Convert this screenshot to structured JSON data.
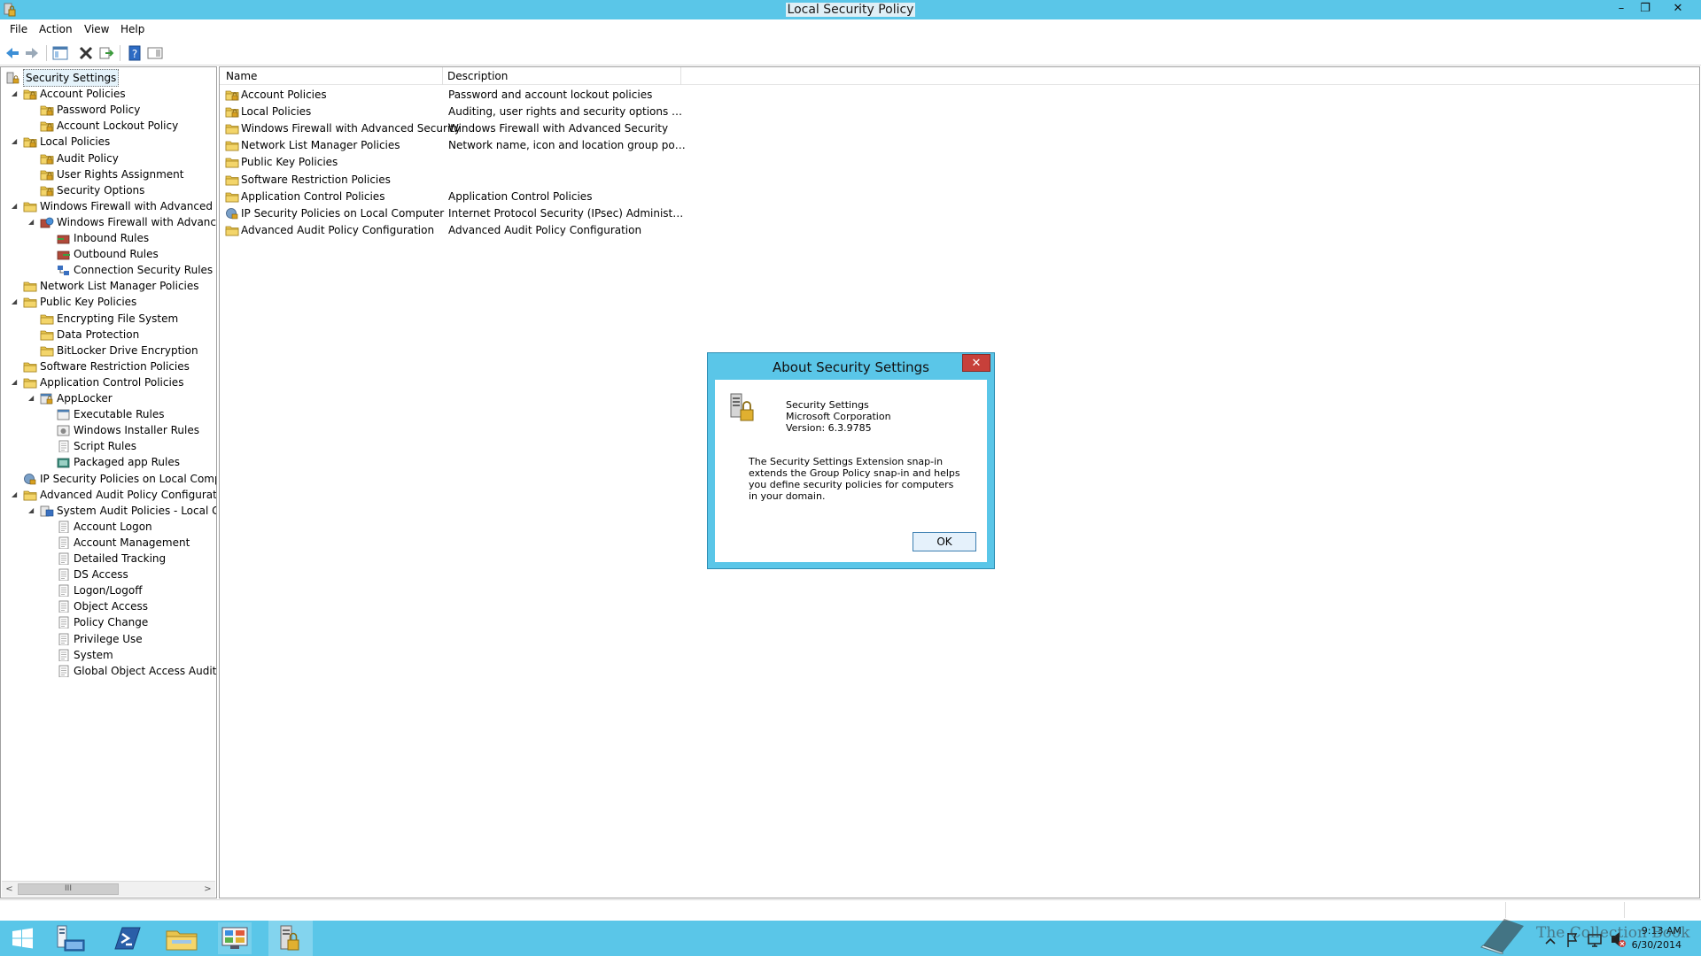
{
  "window": {
    "title": "Local Security Policy",
    "minimize": "–",
    "restore": "❐",
    "close": "✕"
  },
  "menu": [
    "File",
    "Action",
    "View",
    "Help"
  ],
  "tree": [
    {
      "label": "Security Settings",
      "level": 0,
      "expander": "",
      "icon": "security-settings-icon",
      "selected": true
    },
    {
      "label": "Account Policies",
      "level": 1,
      "expander": "◢",
      "icon": "folder-lock-icon"
    },
    {
      "label": "Password Policy",
      "level": 2,
      "expander": "",
      "icon": "folder-lock-icon"
    },
    {
      "label": "Account Lockout Policy",
      "level": 2,
      "expander": "",
      "icon": "folder-lock-icon"
    },
    {
      "label": "Local Policies",
      "level": 1,
      "expander": "◢",
      "icon": "folder-lock-icon"
    },
    {
      "label": "Audit Policy",
      "level": 2,
      "expander": "",
      "icon": "folder-lock-icon"
    },
    {
      "label": "User Rights Assignment",
      "level": 2,
      "expander": "",
      "icon": "folder-lock-icon"
    },
    {
      "label": "Security Options",
      "level": 2,
      "expander": "",
      "icon": "folder-lock-icon"
    },
    {
      "label": "Windows Firewall with Advanced Secu",
      "level": 1,
      "expander": "◢",
      "icon": "folder-icon"
    },
    {
      "label": "Windows Firewall with Advanced",
      "level": 2,
      "expander": "◢",
      "icon": "firewall-icon"
    },
    {
      "label": "Inbound Rules",
      "level": 3,
      "expander": "",
      "icon": "inbound-rules-icon"
    },
    {
      "label": "Outbound Rules",
      "level": 3,
      "expander": "",
      "icon": "outbound-rules-icon"
    },
    {
      "label": "Connection Security Rules",
      "level": 3,
      "expander": "",
      "icon": "connection-security-icon"
    },
    {
      "label": "Network List Manager Policies",
      "level": 1,
      "expander": "",
      "icon": "folder-icon"
    },
    {
      "label": "Public Key Policies",
      "level": 1,
      "expander": "◢",
      "icon": "folder-icon"
    },
    {
      "label": "Encrypting File System",
      "level": 2,
      "expander": "",
      "icon": "folder-icon"
    },
    {
      "label": "Data Protection",
      "level": 2,
      "expander": "",
      "icon": "folder-icon"
    },
    {
      "label": "BitLocker Drive Encryption",
      "level": 2,
      "expander": "",
      "icon": "folder-icon"
    },
    {
      "label": "Software Restriction Policies",
      "level": 1,
      "expander": "",
      "icon": "folder-icon"
    },
    {
      "label": "Application Control Policies",
      "level": 1,
      "expander": "◢",
      "icon": "folder-icon"
    },
    {
      "label": "AppLocker",
      "level": 2,
      "expander": "◢",
      "icon": "applocker-icon"
    },
    {
      "label": "Executable Rules",
      "level": 3,
      "expander": "",
      "icon": "rules-icon"
    },
    {
      "label": "Windows Installer Rules",
      "level": 3,
      "expander": "",
      "icon": "installer-rules-icon"
    },
    {
      "label": "Script Rules",
      "level": 3,
      "expander": "",
      "icon": "script-rules-icon"
    },
    {
      "label": "Packaged app Rules",
      "level": 3,
      "expander": "",
      "icon": "packaged-app-icon"
    },
    {
      "label": "IP Security Policies on Local Compute",
      "level": 1,
      "expander": "",
      "icon": "ipsec-icon"
    },
    {
      "label": "Advanced Audit Policy Configuration",
      "level": 1,
      "expander": "◢",
      "icon": "folder-icon"
    },
    {
      "label": "System Audit Policies - Local Grou",
      "level": 2,
      "expander": "◢",
      "icon": "audit-policies-icon"
    },
    {
      "label": "Account Logon",
      "level": 3,
      "expander": "",
      "icon": "policy-doc-icon"
    },
    {
      "label": "Account Management",
      "level": 3,
      "expander": "",
      "icon": "policy-doc-icon"
    },
    {
      "label": "Detailed Tracking",
      "level": 3,
      "expander": "",
      "icon": "policy-doc-icon"
    },
    {
      "label": "DS Access",
      "level": 3,
      "expander": "",
      "icon": "policy-doc-icon"
    },
    {
      "label": "Logon/Logoff",
      "level": 3,
      "expander": "",
      "icon": "policy-doc-icon"
    },
    {
      "label": "Object Access",
      "level": 3,
      "expander": "",
      "icon": "policy-doc-icon"
    },
    {
      "label": "Policy Change",
      "level": 3,
      "expander": "",
      "icon": "policy-doc-icon"
    },
    {
      "label": "Privilege Use",
      "level": 3,
      "expander": "",
      "icon": "policy-doc-icon"
    },
    {
      "label": "System",
      "level": 3,
      "expander": "",
      "icon": "policy-doc-icon"
    },
    {
      "label": "Global Object Access Auditing",
      "level": 3,
      "expander": "",
      "icon": "policy-doc-icon"
    }
  ],
  "scrollbar": {
    "left": "<",
    "right": ">",
    "grip": "III"
  },
  "list": {
    "columns": [
      "Name",
      "Description"
    ],
    "rows": [
      {
        "name": "Account Policies",
        "desc": "Password and account lockout policies",
        "icon": "folder-lock-icon"
      },
      {
        "name": "Local Policies",
        "desc": "Auditing, user rights and security options polici...",
        "icon": "folder-lock-icon"
      },
      {
        "name": "Windows Firewall with Advanced Security",
        "desc": "Windows Firewall with Advanced Security",
        "icon": "folder-icon"
      },
      {
        "name": "Network List Manager Policies",
        "desc": "Network name, icon and location group policies.",
        "icon": "folder-icon"
      },
      {
        "name": "Public Key Policies",
        "desc": "",
        "icon": "folder-icon"
      },
      {
        "name": "Software Restriction Policies",
        "desc": "",
        "icon": "folder-icon"
      },
      {
        "name": "Application Control Policies",
        "desc": "Application Control Policies",
        "icon": "folder-icon"
      },
      {
        "name": "IP Security Policies on Local Computer",
        "desc": "Internet Protocol Security (IPsec) Administratio...",
        "icon": "ipsec-icon"
      },
      {
        "name": "Advanced Audit Policy Configuration",
        "desc": "Advanced Audit Policy Configuration",
        "icon": "folder-icon"
      }
    ]
  },
  "dialog": {
    "title": "About Security Settings",
    "close": "✕",
    "product": "Security Settings",
    "company": "Microsoft Corporation",
    "version": "Version: 6.3.9785",
    "description": "The Security Settings Extension snap-in extends the Group Policy snap-in and helps you define security policies for computers in your domain.",
    "ok": "OK"
  },
  "taskbar": {
    "time": "9:13 AM",
    "date": "6/30/2014",
    "watermark": "The Collection Book"
  },
  "colors": {
    "accent": "#5ac6e8",
    "folder": "#e8c44e",
    "close_red": "#c7403a"
  }
}
